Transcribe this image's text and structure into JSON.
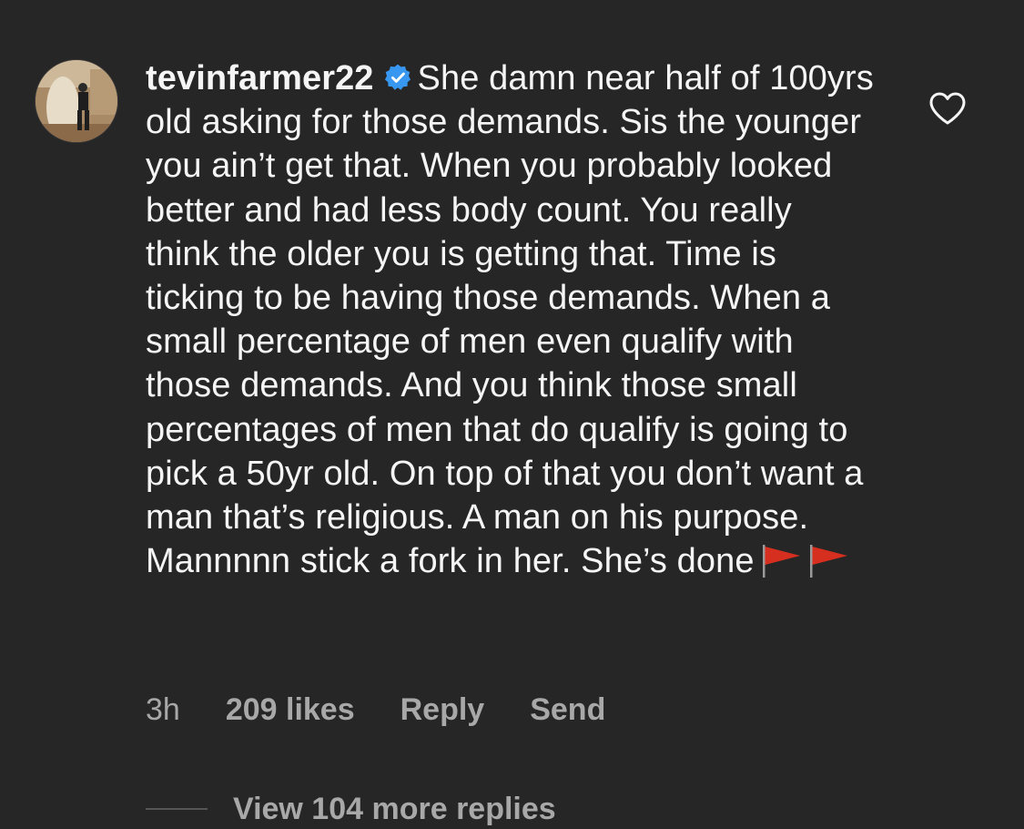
{
  "comment": {
    "username": "tevinfarmer22",
    "verified": true,
    "avatar_icon": "profile-photo",
    "text": "She damn near half of 100yrs old asking for those demands. Sis the younger you ain’t get that. When you probably looked better and had less body count. You really think the older you is getting that. Time is ticking to be having those demands. When a small percentage of men even qualify with those demands. And you think those small percentages of men that do qualify is going to pick a 50yr old. On top of that you don’t want a man that’s religious. A man on his purpose. Mannnnn stick a fork in her. She’s done",
    "emojis": [
      "red-flag",
      "red-flag"
    ],
    "time": "3h",
    "likes": "209 likes",
    "reply_label": "Reply",
    "send_label": "Send",
    "like_icon": "heart-outline-icon"
  },
  "view_replies": {
    "label": "View 104 more replies"
  },
  "colors": {
    "background": "#262626",
    "text": "#f5f5f5",
    "meta": "#a8a8a8",
    "verified_badge": "#3897f0",
    "flag": "#d62e1f"
  }
}
